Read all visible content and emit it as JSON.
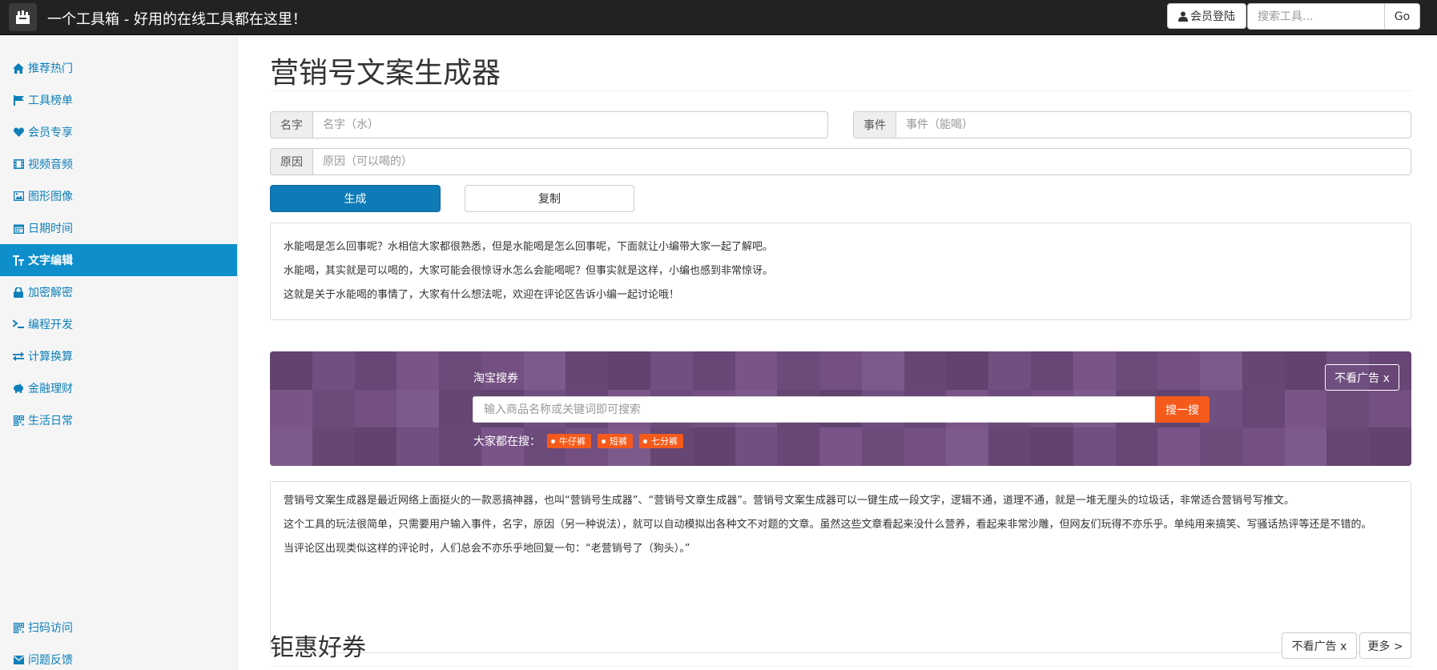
{
  "navbar": {
    "title": "一个工具箱 - 好用的在线工具都在这里！",
    "login_label": "会员登陆",
    "search_placeholder": "搜索工具...",
    "go_label": "Go"
  },
  "sidebar": {
    "items": [
      {
        "label": "推荐热门",
        "icon": "home-icon"
      },
      {
        "label": "工具榜单",
        "icon": "flag-icon"
      },
      {
        "label": "会员专享",
        "icon": "heart-icon"
      },
      {
        "label": "视频音频",
        "icon": "film-icon"
      },
      {
        "label": "图形图像",
        "icon": "picture-icon"
      },
      {
        "label": "日期时间",
        "icon": "calendar-icon"
      },
      {
        "label": "文字编辑",
        "icon": "text-size-icon"
      },
      {
        "label": "加密解密",
        "icon": "lock-icon"
      },
      {
        "label": "编程开发",
        "icon": "console-icon"
      },
      {
        "label": "计算换算",
        "icon": "transfer-icon"
      },
      {
        "label": "金融理财",
        "icon": "piggy-bank-icon"
      },
      {
        "label": "生活日常",
        "icon": "qrcode-icon"
      }
    ],
    "bottom": [
      {
        "label": "扫码访问",
        "icon": "qrcode-icon"
      },
      {
        "label": "问题反馈",
        "icon": "envelope-icon"
      }
    ],
    "active_index": 6
  },
  "form": {
    "title": "营销号文案生成器",
    "name_label": "名字",
    "name_placeholder": "名字（水）",
    "event_label": "事件",
    "event_placeholder": "事件（能喝）",
    "reason_label": "原因",
    "reason_placeholder": "原因（可以喝的）",
    "generate_label": "生成",
    "copy_label": "复制"
  },
  "output": {
    "lines": [
      "水能喝是怎么回事呢？水相信大家都很熟悉，但是水能喝是怎么回事呢，下面就让小编带大家一起了解吧。",
      "水能喝，其实就是可以喝的，大家可能会很惊讶水怎么会能喝呢？但事实就是这样，小编也感到非常惊讶。",
      "这就是关于水能喝的事情了，大家有什么想法呢，欢迎在评论区告诉小编一起讨论哦！"
    ]
  },
  "ad": {
    "label": "淘宝搜券",
    "search_placeholder": "输入商品名称或关键词即可搜索",
    "search_button": "搜一搜",
    "hot_label": "大家都在搜：",
    "tags": [
      "牛仔裤",
      "短裤",
      "七分裤"
    ],
    "close_label": "不看广告 x",
    "accent_color": "#f55a1b",
    "bg_color": "#6a4a78"
  },
  "description": {
    "paragraphs": [
      "营销号文案生成器是最近网络上面挺火的一款恶搞神器，也叫“营销号生成器”、“营销号文章生成器”。营销号文案生成器可以一键生成一段文字，逻辑不通，道理不通，就是一堆无厘头的垃圾话，非常适合营销号写推文。",
      "这个工具的玩法很简单，只需要用户输入事件，名字，原因（另一种说法），就可以自动模拟出各种文不对题的文章。虽然这些文章看起来没什么营养，看起来非常沙雕，但网友们玩得不亦乐乎。单纯用来搞笑、写骚话热评等还是不错的。",
      "当评论区出现类似这样的评论时，人们总会不亦乐乎地回复一句：“老营销号了（狗头）。”"
    ]
  },
  "coupons": {
    "title": "钜惠好券",
    "no_ad_label": "不看广告 x",
    "more_label": "更多 >"
  }
}
